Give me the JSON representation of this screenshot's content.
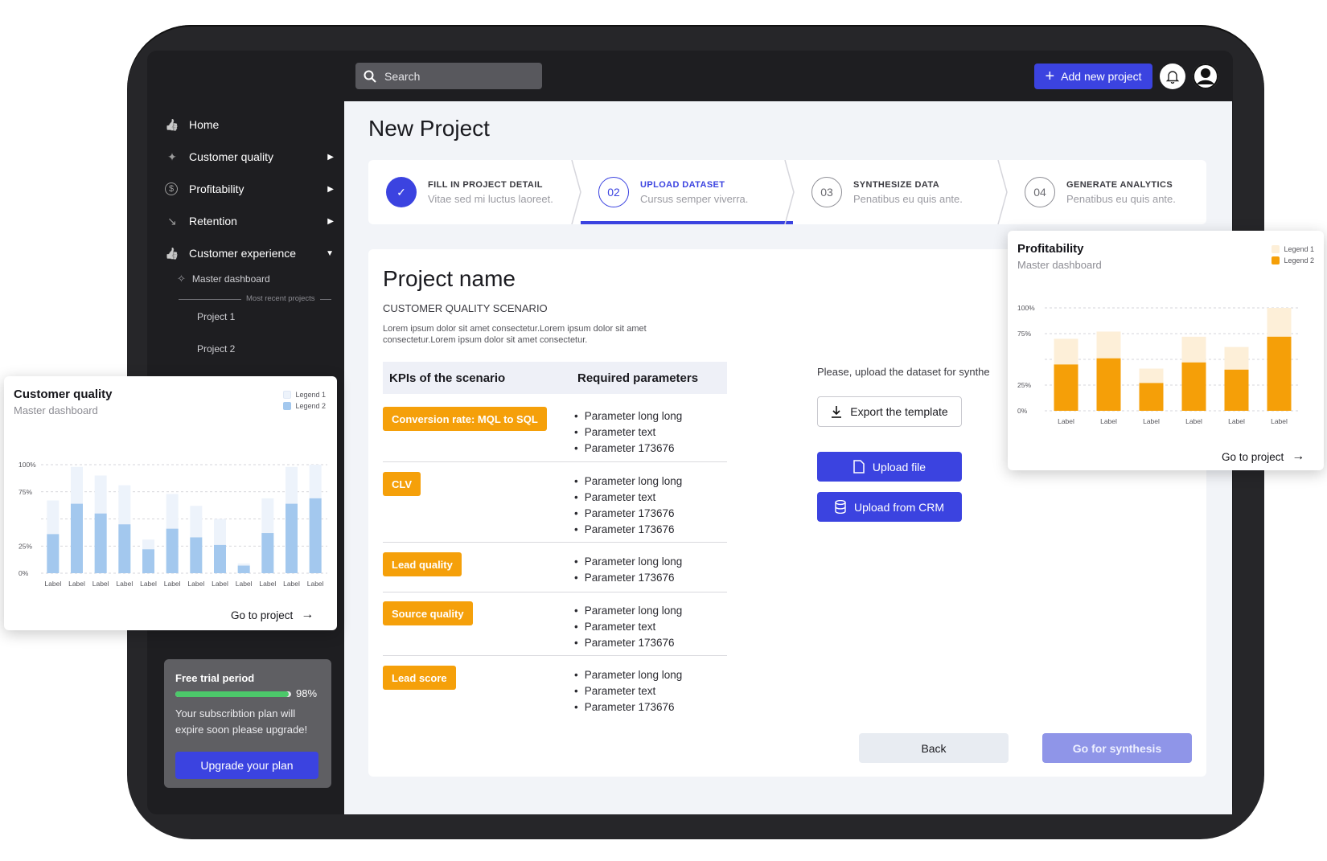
{
  "header": {
    "search_placeholder": "Search",
    "add_button": "Add new project"
  },
  "sidebar": {
    "items": [
      {
        "label": "Home",
        "icon": "thumbs-up-icon",
        "arrow": ""
      },
      {
        "label": "Customer quality",
        "icon": "sparkle-icon",
        "arrow": "▶"
      },
      {
        "label": "Profitability",
        "icon": "dollar-icon",
        "arrow": "▶"
      },
      {
        "label": "Retention",
        "icon": "trend-down-icon",
        "arrow": "▶"
      },
      {
        "label": "Customer experience",
        "icon": "thumbs-up-icon",
        "arrow": "▼"
      }
    ],
    "sub_master": "Master dashboard",
    "recent_label": "Most recent projects",
    "projects": [
      "Project 1",
      "Project 2"
    ],
    "trial": {
      "title": "Free trial period",
      "percent_text": "98%",
      "progress": 0.98,
      "message": "Your subscribtion plan will expire soon please upgrade!",
      "button": "Upgrade your plan"
    }
  },
  "page": {
    "title": "New Project",
    "steps": [
      {
        "num": "",
        "title": "FILL IN PROJECT DETAIL",
        "desc": "Vitae sed mi luctus laoreet.",
        "state": "done"
      },
      {
        "num": "02",
        "title": "UPLOAD DATASET",
        "desc": "Cursus semper viverra.",
        "state": "active"
      },
      {
        "num": "03",
        "title": "SYNTHESIZE DATA",
        "desc": "Penatibus eu quis ante.",
        "state": "pending"
      },
      {
        "num": "04",
        "title": "GENERATE ANALYTICS",
        "desc": "Penatibus eu quis ante.",
        "state": "pending"
      }
    ],
    "project_name": "Project name",
    "scenario": "CUSTOMER QUALITY SCENARIO",
    "description": "Lorem ipsum dolor sit amet consectetur.Lorem ipsum dolor sit amet consectetur.Lorem ipsum dolor sit amet consectetur.",
    "table_headers": [
      "KPIs of the scenario",
      "Required parameters"
    ],
    "kpis": [
      {
        "tag": "Conversion rate: MQL to SQL",
        "params": [
          "Parameter long long",
          "Parameter text",
          "Parameter 173676"
        ]
      },
      {
        "tag": "CLV",
        "params": [
          "Parameter long long",
          "Parameter text",
          "Parameter 173676",
          "Parameter 173676"
        ]
      },
      {
        "tag": "Lead quality",
        "params": [
          "Parameter long long",
          "Parameter 173676"
        ]
      },
      {
        "tag": "Source quality",
        "params": [
          "Parameter long long",
          "Parameter text",
          "Parameter 173676"
        ]
      },
      {
        "tag": "Lead score",
        "params": [
          "Parameter long long",
          "Parameter text",
          "Parameter 173676"
        ]
      }
    ],
    "upload_prompt": "Please, upload the dataset for synthe",
    "export_button": "Export the template",
    "upload_file_button": "Upload file",
    "upload_crm_button": "Upload from CRM",
    "back_button": "Back",
    "synthesis_button": "Go for synthesis"
  },
  "chart_data": [
    {
      "type": "bar",
      "title": "Customer quality",
      "subtitle": "Master dashboard",
      "legend": [
        "Legend 1",
        "Legend 2"
      ],
      "legend_placement": "top-right",
      "colors": {
        "Legend 1": "#edf3fb",
        "Legend 2": "#a3c8ee"
      },
      "y_ticks": [
        "100%",
        "75%",
        "25%",
        "0%"
      ],
      "categories": [
        "Label",
        "Label",
        "Label",
        "Label",
        "Label",
        "Label",
        "Label",
        "Label",
        "Label",
        "Label",
        "Label",
        "Label"
      ],
      "series": [
        {
          "name": "Legend 2",
          "values": [
            0.36,
            0.64,
            0.55,
            0.45,
            0.22,
            0.41,
            0.33,
            0.26,
            0.07,
            0.37,
            0.64,
            0.69
          ]
        },
        {
          "name": "Legend 1",
          "values": [
            0.67,
            0.98,
            0.9,
            0.81,
            0.31,
            0.73,
            0.62,
            0.5,
            0.09,
            0.69,
            0.98,
            1.0
          ]
        }
      ],
      "goto": "Go to project",
      "grid": true
    },
    {
      "type": "bar",
      "title": "Profitability",
      "subtitle": "Master dashboard",
      "legend": [
        "Legend 1",
        "Legend 2"
      ],
      "legend_placement": "top-right",
      "colors": {
        "Legend 1": "#fdefd8",
        "Legend 2": "#f59f08"
      },
      "y_ticks": [
        "100%",
        "75%",
        "25%",
        "0%"
      ],
      "categories": [
        "Label",
        "Label",
        "Label",
        "Label",
        "Label",
        "Label"
      ],
      "series": [
        {
          "name": "Legend 2",
          "values": [
            0.45,
            0.51,
            0.27,
            0.47,
            0.4,
            0.72
          ]
        },
        {
          "name": "Legend 1",
          "values": [
            0.7,
            0.77,
            0.41,
            0.72,
            0.62,
            1.0
          ]
        }
      ],
      "goto": "Go to project",
      "grid": true
    }
  ]
}
